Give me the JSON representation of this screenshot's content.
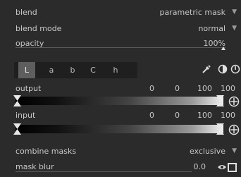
{
  "blend": {
    "label": "blend",
    "value": "parametric mask"
  },
  "blend_mode": {
    "label": "blend mode",
    "value": "normal"
  },
  "opacity": {
    "label": "opacity",
    "value": "100%",
    "fraction": 1.0
  },
  "channel_tabs": [
    "L",
    "a",
    "b",
    "C",
    "h"
  ],
  "active_tab_index": 0,
  "header_icons": [
    "picker-icon",
    "invert-polarity-icon",
    "reset-icon"
  ],
  "output": {
    "label": "output",
    "values": [
      "0",
      "0",
      "100",
      "100"
    ]
  },
  "input": {
    "label": "input",
    "values": [
      "0",
      "0",
      "100",
      "100"
    ]
  },
  "combine_masks": {
    "label": "combine masks",
    "value": "exclusive"
  },
  "mask_blur": {
    "label": "mask blur",
    "value": "0.0"
  },
  "dropdown_arrow": "▼",
  "colors": {
    "background": "#2b2b2b",
    "text": "#c8c8c8",
    "active_tab": "#5e5e5e"
  }
}
